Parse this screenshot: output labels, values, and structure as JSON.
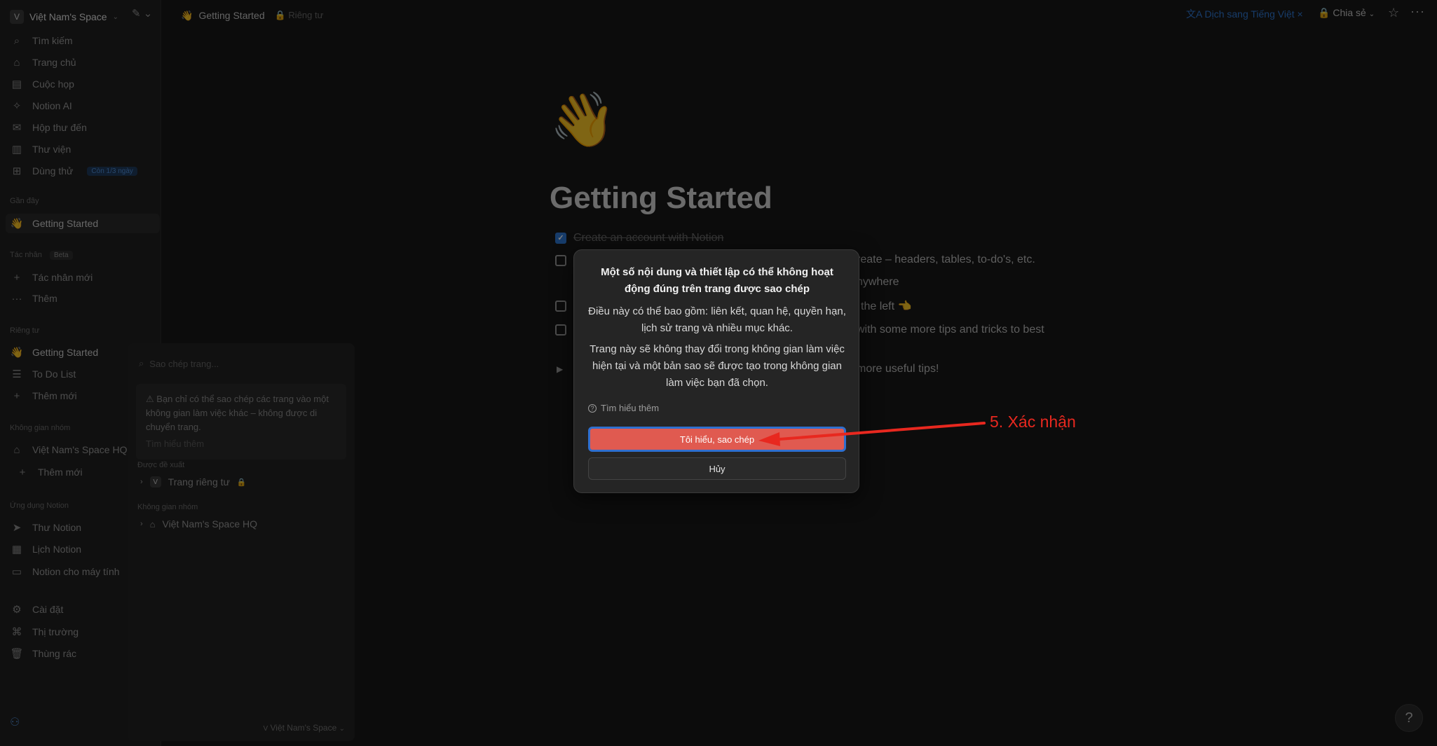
{
  "workspace": {
    "avatar": "V",
    "name": "Việt Nam's Space"
  },
  "topbar": {
    "page_title": "Getting Started",
    "page_emoji": "👋",
    "privacy": "Riêng tư",
    "translate": "Dịch sang Tiếng Việt",
    "translate_close": "×",
    "share": "Chia sẻ",
    "more": "···"
  },
  "sidebar": {
    "nav": [
      {
        "label": "Tìm kiếm",
        "icon": "search-icon"
      },
      {
        "label": "Trang chủ",
        "icon": "home-icon"
      },
      {
        "label": "Cuộc họp",
        "icon": "meeting-icon"
      },
      {
        "label": "Notion AI",
        "icon": "ai-icon"
      },
      {
        "label": "Hộp thư đến",
        "icon": "inbox-icon"
      },
      {
        "label": "Thư viện",
        "icon": "library-icon"
      },
      {
        "label": "Dùng thử",
        "icon": "gift-icon",
        "badge": "Còn 1/3 ngày"
      }
    ],
    "recent": {
      "title": "Gần đây",
      "items": [
        {
          "label": "Getting Started"
        }
      ]
    },
    "agents": {
      "title": "Tác nhân",
      "badge": "Beta",
      "items": [
        {
          "label": "Tác nhân mới"
        },
        {
          "label": "Thêm"
        }
      ]
    },
    "private": {
      "title": "Riêng tư",
      "items": [
        {
          "label": "Getting Started"
        },
        {
          "label": "To Do List"
        },
        {
          "label": "Thêm mới"
        }
      ]
    },
    "teamspaces": {
      "title": "Không gian nhóm",
      "items": [
        {
          "label": "Việt Nam's Space HQ"
        },
        {
          "label": "Thêm mới"
        }
      ]
    },
    "apps": {
      "title": "Ứng dụng Notion",
      "items": [
        {
          "label": "Thư Notion"
        },
        {
          "label": "Lịch Notion"
        },
        {
          "label": "Notion cho máy tính"
        }
      ]
    },
    "bottom": [
      {
        "label": "Cài đặt"
      },
      {
        "label": "Thị trường"
      },
      {
        "label": "Thùng rác"
      }
    ]
  },
  "copy_panel": {
    "search_placeholder": "Sao chép trang...",
    "note": "Bạn chỉ có thể sao chép các trang vào một không gian làm việc khác – không được di chuyển trang.",
    "note_link": "Tìm hiểu thêm",
    "suggested_title": "Được đề xuất",
    "suggested_item": "Trang riêng tư",
    "suggested_avatar": "V",
    "teamspace_title": "Không gian nhóm",
    "teamspace_item": "Việt Nam's Space HQ",
    "footer_workspace": "Việt Nam's Space"
  },
  "page": {
    "emoji": "👋",
    "title": "Getting Started",
    "todos": [
      {
        "text": "Create an account with Notion",
        "checked": true
      },
      {
        "text": "reate – headers, tables, to-do's, etc."
      },
      {
        "text": "nywhere"
      },
      {
        "text": "the left 👈"
      },
      {
        "text": "with some more tips and tricks to best"
      },
      {
        "text": "more useful tips!"
      }
    ]
  },
  "modal": {
    "title": "Một số nội dung và thiết lập có thể không hoạt động đúng trên trang được sao chép",
    "body1": "Điều này có thể bao gồm: liên kết, quan hệ, quyền hạn, lịch sử trang và nhiều mục khác.",
    "body2": "Trang này sẽ không thay đổi trong không gian làm việc hiện tại và một bản sao sẽ được tạo trong không gian làm việc bạn đã chọn.",
    "learn_more": "Tìm hiểu thêm",
    "confirm": "Tôi hiểu, sao chép",
    "cancel": "Hủy"
  },
  "annotation": {
    "label": "5. Xác nhận",
    "color": "#e8281f"
  },
  "colors": {
    "accent": "#2f78d4",
    "confirm_bg": "#e05a50",
    "annotation": "#e8281f"
  }
}
